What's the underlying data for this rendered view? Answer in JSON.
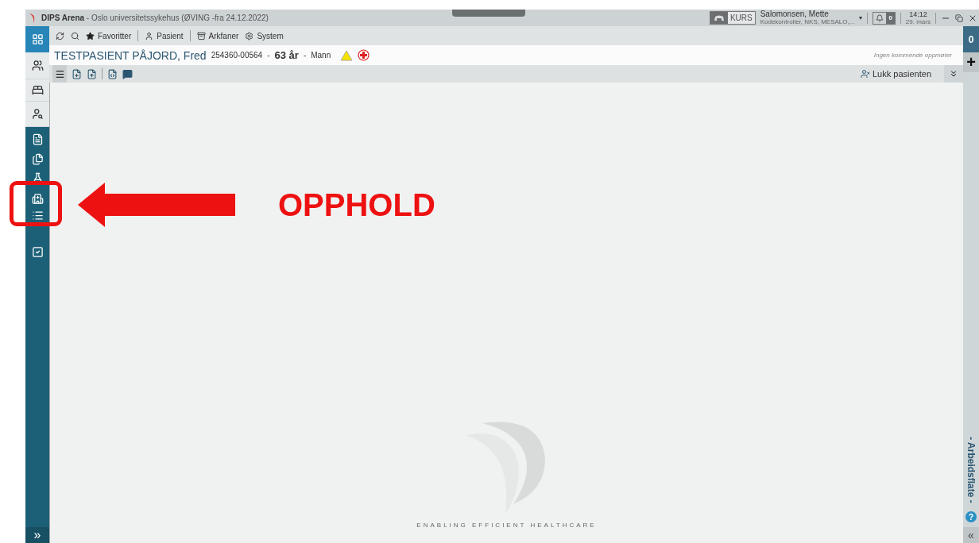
{
  "title_bar": {
    "app_name": "DIPS Arena",
    "subtitle": " - Oslo universitetssykehus (ØVING -fra 24.12.2022)",
    "mode": "KURS",
    "user_name": "Salomonsen, Mette",
    "user_role": "Kodekontroller, NKS, MESALO,...",
    "notifications": "0",
    "time": "14:12",
    "date": "29. mars",
    "caret": "▾"
  },
  "toolbar": {
    "items": [
      {
        "kind": "icon"
      },
      {
        "kind": "icon"
      },
      {
        "kind": "menu",
        "label": "Favoritter"
      },
      {
        "kind": "menu",
        "label": "Pasient"
      },
      {
        "kind": "menu",
        "label": "Arkfaner"
      },
      {
        "kind": "menu",
        "label": "System"
      }
    ]
  },
  "patient": {
    "name": "TESTPASIENT PÅJORD, Fred",
    "id": "254360-00564",
    "separator_1": "-",
    "age": "63 år",
    "separator_2": "-",
    "sex": "Mann",
    "warning": true,
    "critical_info": true,
    "appointments": "Ingen kommende oppmøter"
  },
  "action_bar": {
    "close_patient": "Lukk pasienten"
  },
  "left_rail": {
    "items": [
      {
        "selected": true
      },
      {
        "selected": false
      },
      {
        "selected": false
      },
      {
        "selected": false
      },
      {
        "selected": false
      },
      {
        "selected": false
      },
      {
        "selected": false
      },
      {
        "selected": false
      },
      {
        "selected": false
      },
      {
        "selected": false
      }
    ],
    "expand": "»"
  },
  "right_rail": {
    "count": "0",
    "add": "+",
    "workspace": "- Arbeidsflate -",
    "help": "?",
    "collapse": "«"
  },
  "content": {
    "slogan": "ENABLING EFFICIENT HEALTHCARE"
  },
  "annotation": {
    "label": "OPPHOLD"
  }
}
